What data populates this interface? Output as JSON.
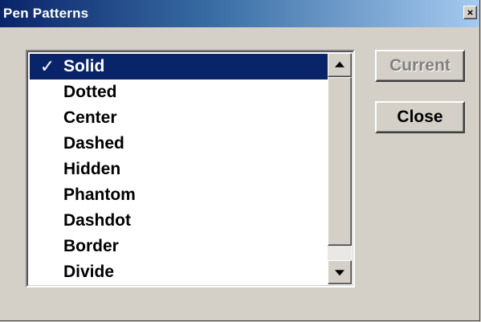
{
  "window": {
    "title": "Pen Patterns",
    "close_glyph": "×"
  },
  "list": {
    "check_glyph": "✓",
    "items": [
      {
        "label": "Solid",
        "selected": true
      },
      {
        "label": "Dotted",
        "selected": false
      },
      {
        "label": "Center",
        "selected": false
      },
      {
        "label": "Dashed",
        "selected": false
      },
      {
        "label": "Hidden",
        "selected": false
      },
      {
        "label": "Phantom",
        "selected": false
      },
      {
        "label": "Dashdot",
        "selected": false
      },
      {
        "label": "Border",
        "selected": false
      },
      {
        "label": "Divide",
        "selected": false
      }
    ]
  },
  "buttons": {
    "current_label": "Current",
    "current_enabled": false,
    "close_label": "Close"
  },
  "colors": {
    "selection": "#0a246a",
    "face": "#d4d0c8"
  }
}
